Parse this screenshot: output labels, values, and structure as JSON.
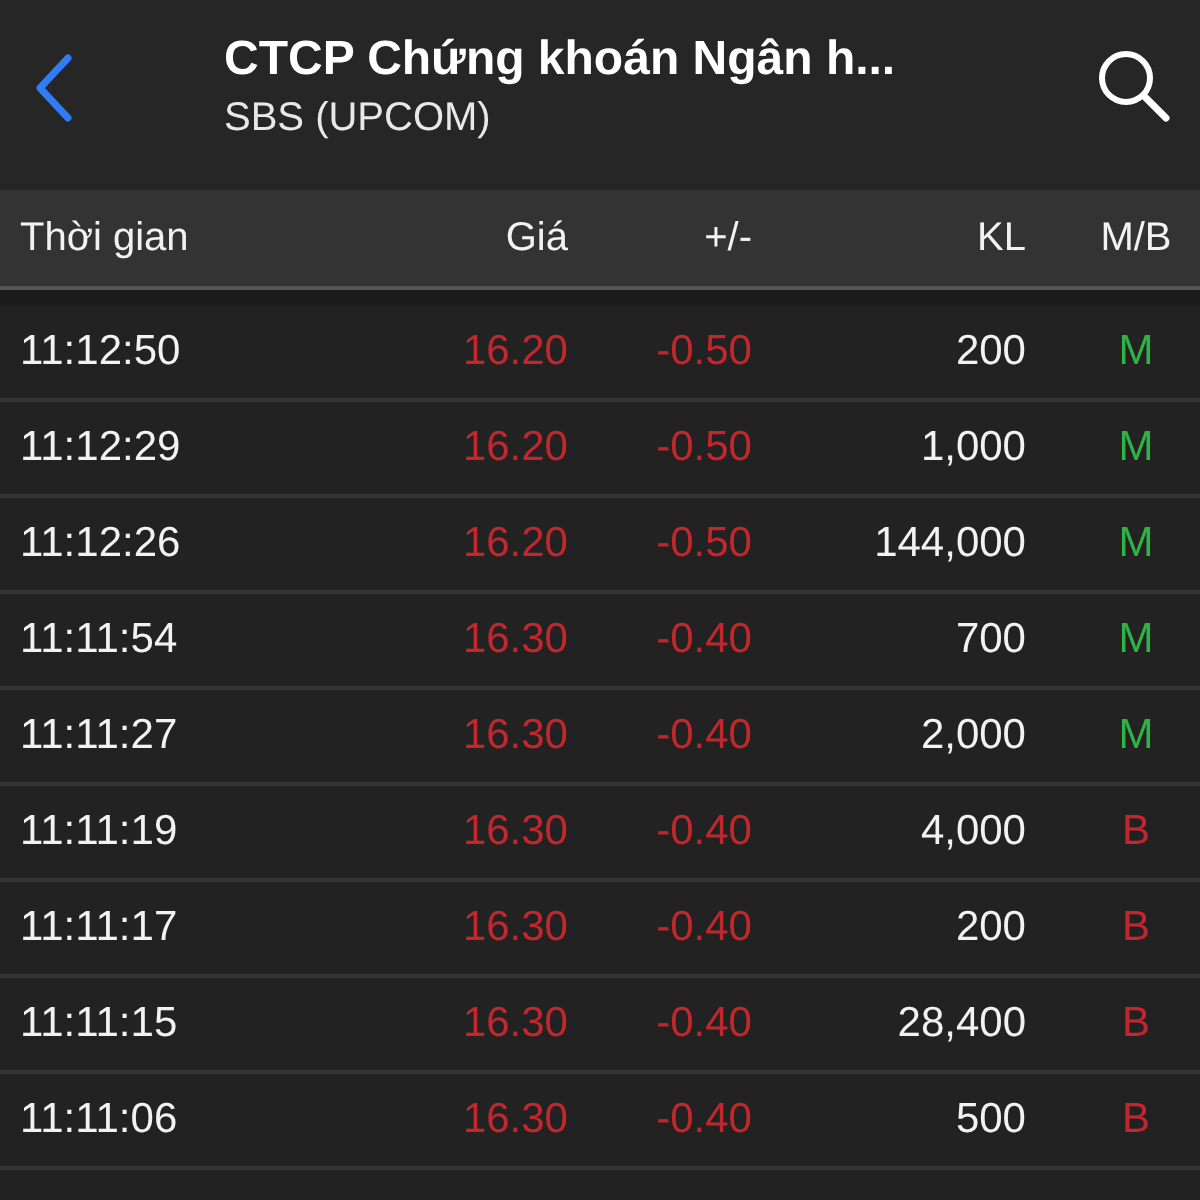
{
  "header": {
    "title": "CTCP Chứng khoán Ngân h...",
    "subtitle": "SBS (UPCOM)"
  },
  "table": {
    "columns": [
      "Thời gian",
      "Giá",
      "+/-",
      "KL",
      "M/B"
    ],
    "rows": [
      {
        "time": "11:12:50",
        "price": "16.20",
        "change": "-0.50",
        "price_down": true,
        "volume": "200",
        "side": "M",
        "buyer": true
      },
      {
        "time": "11:12:29",
        "price": "16.20",
        "change": "-0.50",
        "price_down": true,
        "volume": "1,000",
        "side": "M",
        "buyer": true
      },
      {
        "time": "11:12:26",
        "price": "16.20",
        "change": "-0.50",
        "price_down": true,
        "volume": "144,000",
        "side": "M",
        "buyer": true
      },
      {
        "time": "11:11:54",
        "price": "16.30",
        "change": "-0.40",
        "price_down": true,
        "volume": "700",
        "side": "M",
        "buyer": true
      },
      {
        "time": "11:11:27",
        "price": "16.30",
        "change": "-0.40",
        "price_down": true,
        "volume": "2,000",
        "side": "M",
        "buyer": true
      },
      {
        "time": "11:11:19",
        "price": "16.30",
        "change": "-0.40",
        "price_down": true,
        "volume": "4,000",
        "side": "B",
        "buyer": false
      },
      {
        "time": "11:11:17",
        "price": "16.30",
        "change": "-0.40",
        "price_down": true,
        "volume": "200",
        "side": "B",
        "buyer": false
      },
      {
        "time": "11:11:15",
        "price": "16.30",
        "change": "-0.40",
        "price_down": true,
        "volume": "28,400",
        "side": "B",
        "buyer": false
      },
      {
        "time": "11:11:06",
        "price": "16.30",
        "change": "-0.40",
        "price_down": true,
        "volume": "500",
        "side": "B",
        "buyer": false
      }
    ]
  }
}
